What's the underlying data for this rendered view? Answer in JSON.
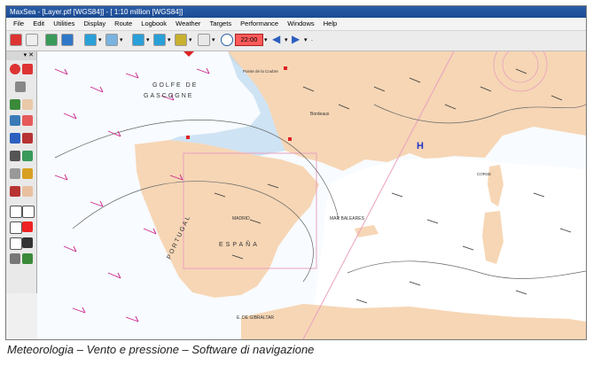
{
  "window": {
    "title": "MaxSea - [Layer.ptf [WGS84]] - [ 1:10 million [WGS84]]"
  },
  "menu": [
    "File",
    "Edit",
    "Utilities",
    "Display",
    "Route",
    "Logbook",
    "Weather",
    "Targets",
    "Performance",
    "Windows",
    "Help"
  ],
  "toolbar": {
    "time": "22:00",
    "icons": [
      "pencil-icon",
      "cursor-icon",
      "grid-icon",
      "globe-icon",
      "chart-icon",
      "weather-icon",
      "layer-icon",
      "route-icon",
      "target-icon",
      "graph-icon",
      "clock-icon",
      "left-arrow-icon",
      "right-arrow-icon"
    ]
  },
  "tools": {
    "icons": [
      "lifebuoy-icon",
      "pencil-icon",
      "magnifier-icon",
      "hand-icon",
      "compass-icon",
      "cursor-icon",
      "route-icon",
      "mark-icon",
      "satellite-icon",
      "arrow-icon",
      "plus-icon",
      "cross-icon",
      "line-icon",
      "fill-icon"
    ]
  },
  "map": {
    "labels": {
      "golfe": "GOLFE DE",
      "gascogne": "GASCOGNE",
      "espana": "ESPAÑA",
      "portugal": "PORTUGAL",
      "bordeaux": "Bordeaux",
      "madrid": "MADRID",
      "baleares": "MAR BALEARES",
      "gibraltar": "E. DE GIBRALTAR",
      "pointe": "Pointe de la Coubre",
      "corse": "CORSE",
      "h_marker": "H"
    }
  },
  "caption": "Meteorologia – Vento e pressione – Software di navigazione"
}
